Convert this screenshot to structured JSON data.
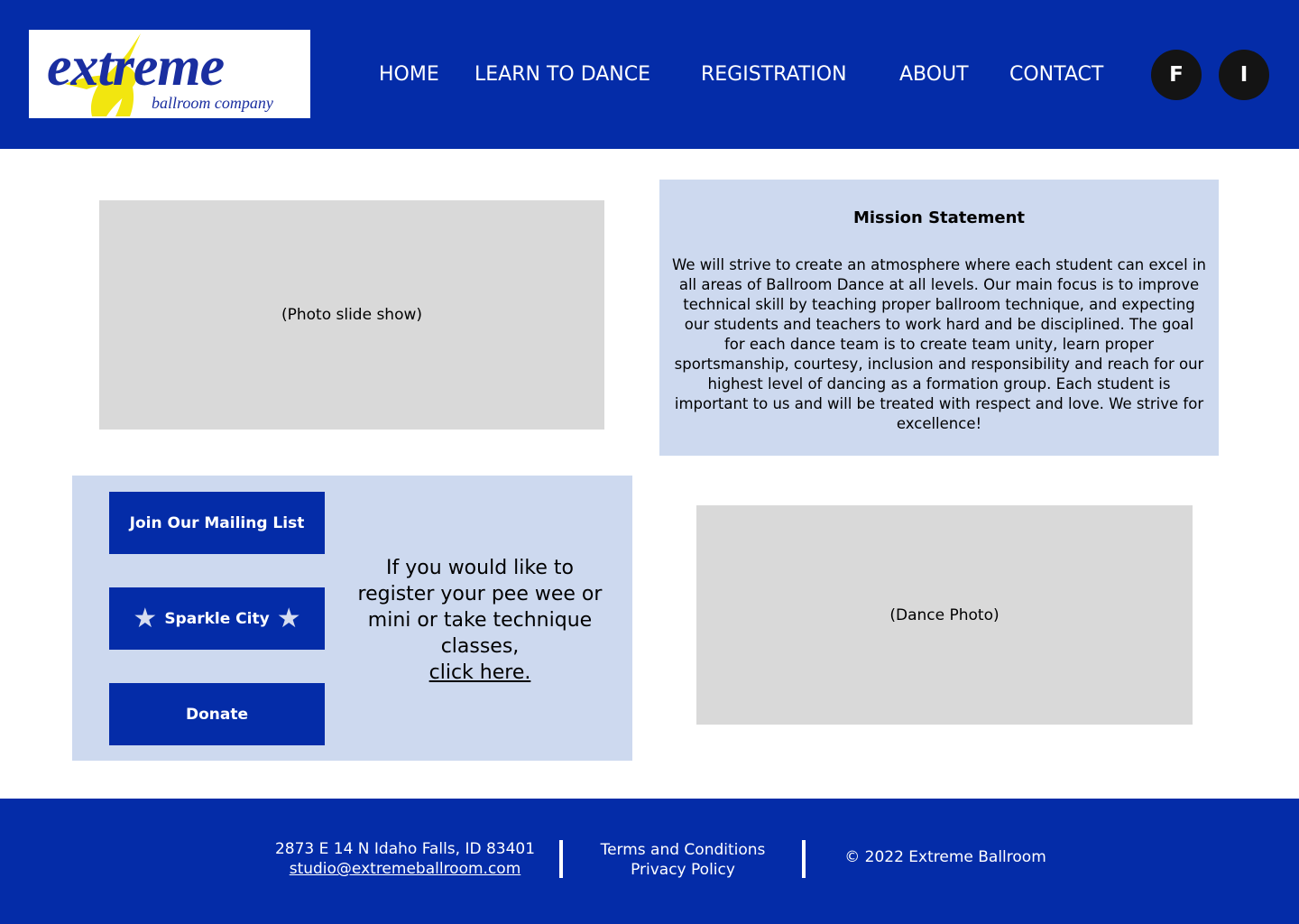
{
  "colors": {
    "brand_blue": "#042ca8",
    "panel_blue": "#cdd9ef",
    "placeholder_gray": "#d9d9d9",
    "social_dark": "#141414",
    "logo_yellow": "#f2e60f"
  },
  "header": {
    "logo": {
      "word": "extreme",
      "tagline": "ballroom company",
      "icon": "dancer-figure-icon"
    },
    "nav": [
      {
        "label": "HOME"
      },
      {
        "label": "LEARN TO DANCE"
      },
      {
        "label": "REGISTRATION"
      },
      {
        "label": "ABOUT"
      },
      {
        "label": "CONTACT"
      }
    ],
    "social": [
      {
        "label": "F",
        "icon": "facebook-icon"
      },
      {
        "label": "I",
        "icon": "instagram-icon"
      }
    ]
  },
  "main": {
    "slideshow_placeholder": "(Photo slide show)",
    "mission": {
      "title": "Mission Statement",
      "body": "We will strive to create an atmosphere where each student can excel in all areas of Ballroom Dance at all levels. Our main focus is to improve technical skill by teaching proper ballroom technique, and expecting our students and teachers to work hard and be disciplined. The goal for each dance team is to create team unity, learn proper sportsmanship, courtesy, inclusion and responsibility and reach for our highest level of dancing as a formation group. Each student is important to us and will be treated with respect and love. We strive for excellence!"
    },
    "actions": {
      "mailing_list": "Join Our Mailing List",
      "sparkle_city": "Sparkle City",
      "donate": "Donate"
    },
    "register": {
      "text": "If you would like to register your pee wee or mini or take technique classes,",
      "link": "click here."
    },
    "dance_photo_placeholder": "(Dance Photo)"
  },
  "footer": {
    "address": "2873 E 14 N Idaho Falls, ID 83401",
    "email": "studio@extremeballroom.com",
    "terms": "Terms and Conditions",
    "privacy": "Privacy Policy",
    "copyright": "© 2022 Extreme Ballroom"
  }
}
